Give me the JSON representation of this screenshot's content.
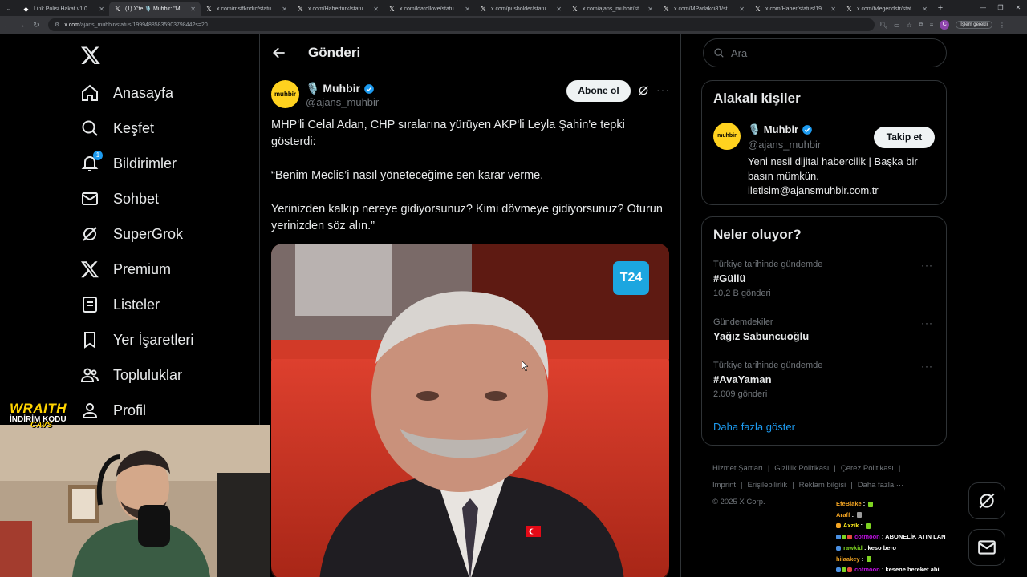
{
  "browser": {
    "tabs": [
      {
        "title": "Link Polisi Hakat v1.0",
        "active": false
      },
      {
        "title": "(1) X'te 🎙️ Muhbir: \"MHP'",
        "active": true
      },
      {
        "title": "x.com/mstfkndrc/status/1999",
        "active": false
      },
      {
        "title": "x.com/Haberturk/status/1999",
        "active": false
      },
      {
        "title": "x.com/ldarollove/status/19400",
        "active": false
      },
      {
        "title": "x.com/pusholder/status/1999",
        "active": false
      },
      {
        "title": "x.com/ajans_muhbir/status/1",
        "active": false
      },
      {
        "title": "x.com/MParlakci81/status/19",
        "active": false
      },
      {
        "title": "x.com/Haber/status/1999488",
        "active": false
      },
      {
        "title": "x.com/tvlegendstr/status/199",
        "active": false
      }
    ],
    "url_domain": "x.com",
    "url_path": "/ajans_muhbir/status/1999488583590379844?s=20",
    "profile_label": "İşlem gerekli"
  },
  "nav": {
    "items": [
      {
        "label": "Anasayfa",
        "icon": "home-icon"
      },
      {
        "label": "Keşfet",
        "icon": "search-icon"
      },
      {
        "label": "Bildirimler",
        "icon": "bell-icon",
        "badge": "1"
      },
      {
        "label": "Sohbet",
        "icon": "mail-icon"
      },
      {
        "label": "SuperGrok",
        "icon": "grok-icon"
      },
      {
        "label": "Premium",
        "icon": "x-logo-icon"
      },
      {
        "label": "Listeler",
        "icon": "list-icon"
      },
      {
        "label": "Yer İşaretleri",
        "icon": "bookmark-icon"
      },
      {
        "label": "Topluluklar",
        "icon": "communities-icon"
      },
      {
        "label": "Profil",
        "icon": "profile-icon"
      }
    ]
  },
  "main": {
    "title": "Gönderi",
    "author": {
      "avatar_text": "muhbir",
      "name": "🎙️ Muhbir",
      "handle": "@ajans_muhbir",
      "subscribe_label": "Abone ol"
    },
    "text": [
      "MHP'li Celal Adan, CHP sıralarına yürüyen AKP'li Leyla Şahin'e tepki gösterdi:",
      "“Benim Meclis’i nasıl yöneteceğime sen karar verme.",
      "Yerinizden kalkıp nereye gidiyorsunuz? Kimi dövmeye gidiyorsunuz? Oturun yerinizden söz alın.”"
    ],
    "media_watermark": "T24"
  },
  "right": {
    "search_placeholder": "Ara",
    "related": {
      "title": "Alakalı kişiler",
      "avatar_text": "muhbir",
      "name": "🎙️ Muhbir",
      "handle": "@ajans_muhbir",
      "follow_label": "Takip et",
      "bio": "Yeni nesil dijital habercilik | Başka bir basın mümkün. iletisim@ajansmuhbir.com.tr"
    },
    "trends": {
      "title": "Neler oluyor?",
      "items": [
        {
          "context": "Türkiye tarihinde gündemde",
          "topic": "#Güllü",
          "count": "10,2 B gönderi"
        },
        {
          "context": "Gündemdekiler",
          "topic": "Yağız Sabuncuoğlu",
          "count": ""
        },
        {
          "context": "Türkiye tarihinde gündemde",
          "topic": "#AvaYaman",
          "count": "2.009 gönderi"
        }
      ],
      "show_more": "Daha fazla göster"
    },
    "footer": {
      "links": [
        "Hizmet Şartları",
        "Gizlilik Politikası",
        "Çerez Politikası",
        "Imprint",
        "Erişilebilirlik",
        "Reklam bilgisi",
        "Daha fazla ···"
      ],
      "copyright": "© 2025 X Corp."
    }
  },
  "overlay": {
    "promo": {
      "line1": "WRAITH",
      "line2": "İNDİRİM KODU",
      "line3": "CAVS"
    },
    "chat": [
      {
        "user": "EfeBlake",
        "color": "#f5a623",
        "msg": ""
      },
      {
        "user": "Araff",
        "color": "#f5a623",
        "msg": ""
      },
      {
        "user": "Axzik",
        "color": "#f8e71c",
        "msg": ""
      },
      {
        "user": "cotmoon",
        "color": "#bd10e0",
        "msg": "ABONELİK ATIN LAN"
      },
      {
        "user": "rawkid",
        "color": "#7ed321",
        "msg": "keso bero"
      },
      {
        "user": "hilaakey",
        "color": "#f5a623",
        "msg": ""
      },
      {
        "user": "cotmoon",
        "color": "#bd10e0",
        "msg": "kesene bereket abi"
      }
    ]
  },
  "colors": {
    "accent": "#1d9bf0",
    "muhbir_yellow": "#ffd21f",
    "border": "#2f3336"
  }
}
